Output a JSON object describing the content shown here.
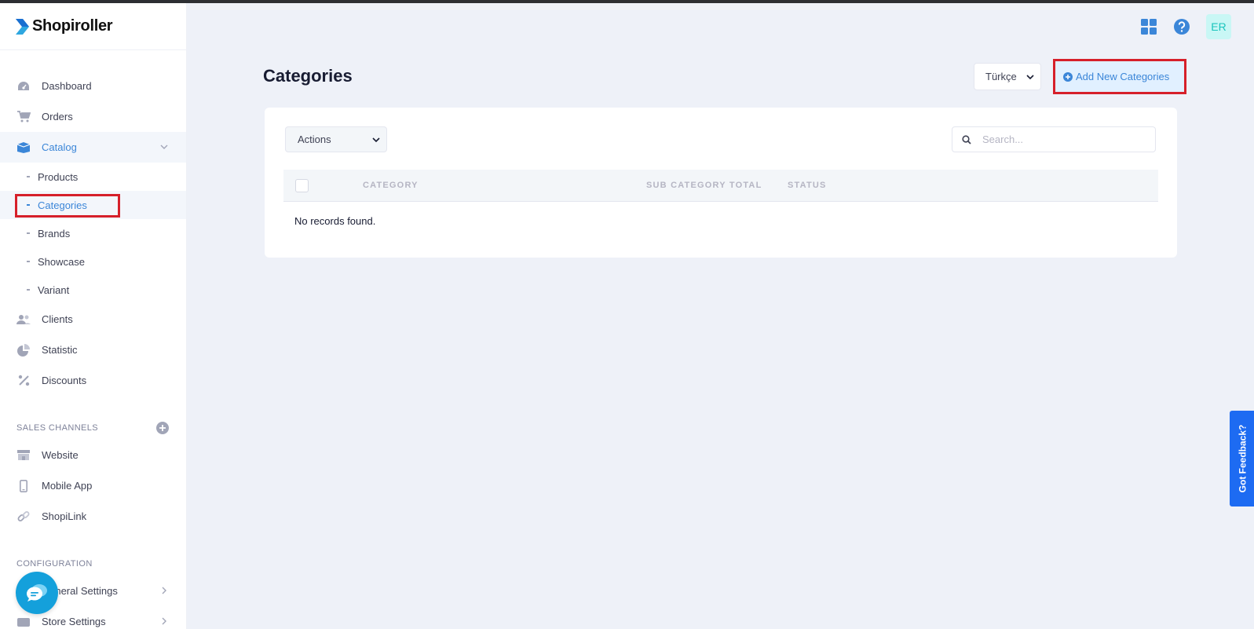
{
  "brand": {
    "name": "Shopiroller"
  },
  "sidebar": {
    "items": [
      {
        "label": "Dashboard",
        "icon": "dashboard-icon"
      },
      {
        "label": "Orders",
        "icon": "cart-icon"
      },
      {
        "label": "Catalog",
        "icon": "box-icon",
        "expanded": true
      }
    ],
    "catalog_children": [
      {
        "label": "Products"
      },
      {
        "label": "Categories",
        "active": true
      },
      {
        "label": "Brands"
      },
      {
        "label": "Showcase"
      },
      {
        "label": "Variant"
      }
    ],
    "items_after": [
      {
        "label": "Clients",
        "icon": "users-icon"
      },
      {
        "label": "Statistic",
        "icon": "pie-chart-icon"
      },
      {
        "label": "Discounts",
        "icon": "percent-icon"
      }
    ],
    "sales_channels_title": "SALES CHANNELS",
    "sales_channels": [
      {
        "label": "Website",
        "icon": "store-icon"
      },
      {
        "label": "Mobile App",
        "icon": "phone-icon"
      },
      {
        "label": "ShopiLink",
        "icon": "link-icon"
      }
    ],
    "configuration_title": "CONFIGURATION",
    "configuration": [
      {
        "label": "General Settings",
        "icon": "settings-icon"
      },
      {
        "label": "Store Settings",
        "icon": "store-settings-icon"
      }
    ]
  },
  "header": {
    "avatar_initials": "ER"
  },
  "page": {
    "title": "Categories",
    "language": "Türkçe",
    "add_button": "Add New Categories"
  },
  "table": {
    "actions_label": "Actions",
    "search_placeholder": "Search...",
    "columns": [
      "CATEGORY",
      "SUB CATEGORY TOTAL",
      "STATUS"
    ],
    "empty_text": "No records found."
  },
  "feedback": {
    "label": "Got Feedback?"
  },
  "colors": {
    "accent": "#3b86d8",
    "highlight": "#d6202a",
    "feedback": "#1d6bf2"
  }
}
